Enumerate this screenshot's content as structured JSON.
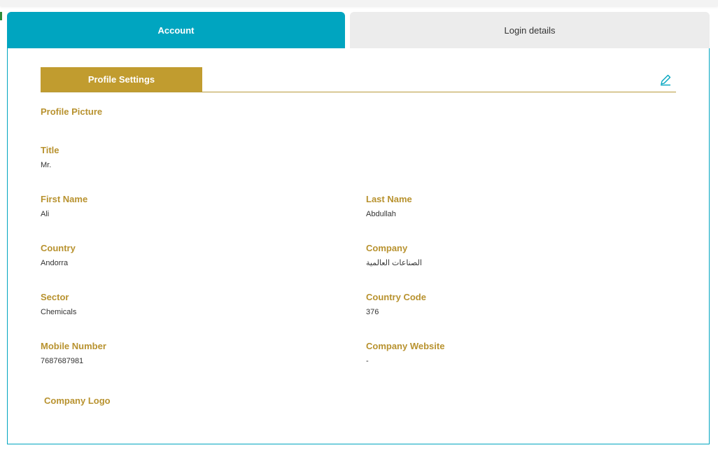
{
  "tabs": {
    "account": "Account",
    "login_details": "Login details"
  },
  "section": {
    "title": "Profile Settings",
    "edit_icon": "pencil-icon"
  },
  "colors": {
    "tab_active": "#00a5c0",
    "tab_inactive": "#ececec",
    "accent_gold": "#c19c2f",
    "label_gold": "#b8922f"
  },
  "profile": {
    "profile_picture_label": "Profile Picture",
    "title": {
      "label": "Title",
      "value": "Mr."
    },
    "first_name": {
      "label": "First Name",
      "value": "Ali"
    },
    "last_name": {
      "label": "Last Name",
      "value": "Abdullah"
    },
    "country": {
      "label": "Country",
      "value": "Andorra"
    },
    "company": {
      "label": "Company",
      "value": "الصناعات العالمية"
    },
    "sector": {
      "label": "Sector",
      "value": "Chemicals"
    },
    "country_code": {
      "label": "Country Code",
      "value": "376"
    },
    "mobile_number": {
      "label": "Mobile Number",
      "value": "7687687981"
    },
    "company_website": {
      "label": "Company Website",
      "value": "-"
    },
    "company_logo_label": "Company Logo"
  }
}
